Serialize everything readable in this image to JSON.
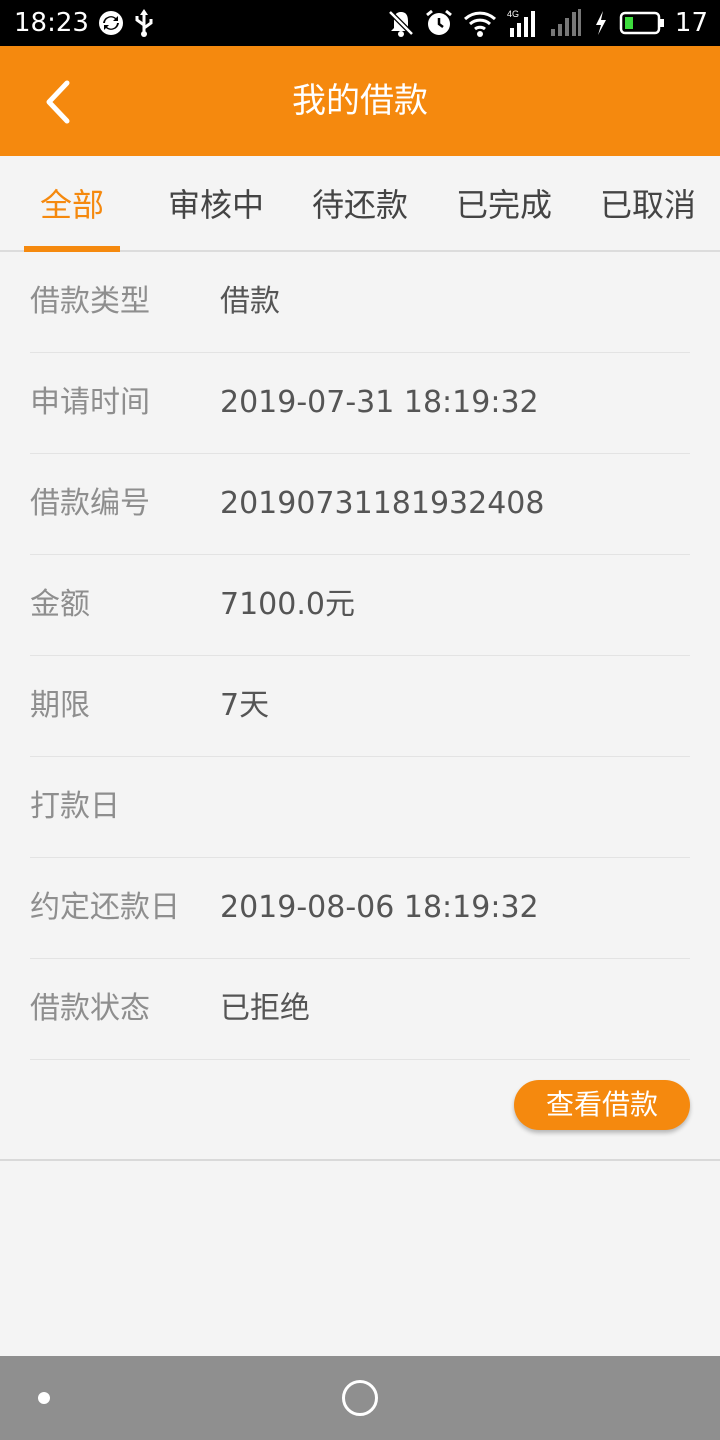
{
  "status_bar": {
    "time": "18:23",
    "battery_level": "17",
    "network_label": "4G",
    "icons": [
      "sync-icon",
      "usb-icon",
      "silent-icon",
      "alarm-icon",
      "wifi-icon",
      "signal-icon",
      "signal-weak-icon",
      "charging-icon",
      "battery-icon"
    ]
  },
  "app_bar": {
    "title": "我的借款",
    "back_icon": "chevron-left-icon"
  },
  "tabs": {
    "active_index": 0,
    "items": [
      {
        "label": "全部"
      },
      {
        "label": "审核中"
      },
      {
        "label": "待还款"
      },
      {
        "label": "已完成"
      },
      {
        "label": "已取消"
      }
    ]
  },
  "loan": {
    "rows": [
      {
        "label": "借款类型",
        "value": "借款"
      },
      {
        "label": "申请时间",
        "value": "2019-07-31 18:19:32"
      },
      {
        "label": "借款编号",
        "value": "20190731181932408"
      },
      {
        "label": "金额",
        "value": "7100.0元"
      },
      {
        "label": "期限",
        "value": "7天"
      },
      {
        "label": "打款日",
        "value": ""
      },
      {
        "label": "约定还款日",
        "value": "2019-08-06 18:19:32"
      },
      {
        "label": "借款状态",
        "value": "已拒绝"
      }
    ],
    "view_button": "查看借款"
  },
  "colors": {
    "accent": "#f5890e",
    "background": "#f4f4f4",
    "nav_bar": "#8f8f8f"
  },
  "nav_bar": {
    "icons": [
      "recent-apps-dot-icon",
      "home-circle-icon"
    ]
  }
}
